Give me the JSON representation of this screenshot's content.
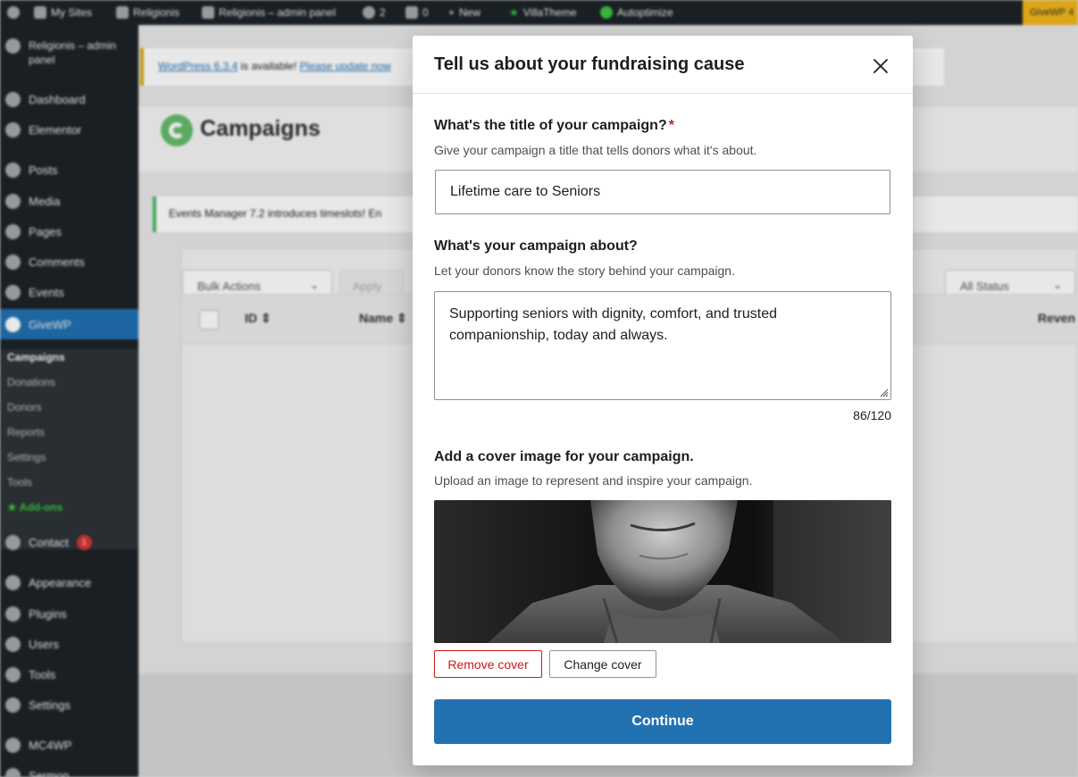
{
  "admin_bar": {
    "my_sites": "My Sites",
    "site_name": "Religionis",
    "admin_panel": "Religionis – admin panel",
    "updates_count": "2",
    "comments_count": "0",
    "new_label": "New",
    "villatheme": "VillaTheme",
    "autoptimize": "Autoptimize",
    "givewp_badge": "GiveWP 4"
  },
  "sidebar": {
    "site_title": "Religionis – admin panel",
    "items": [
      {
        "label": "Dashboard",
        "icon": "dashboard-icon"
      },
      {
        "label": "Elementor",
        "icon": "elementor-icon"
      },
      {
        "label": "Posts",
        "icon": "pin-icon"
      },
      {
        "label": "Media",
        "icon": "media-icon"
      },
      {
        "label": "Pages",
        "icon": "pages-icon"
      },
      {
        "label": "Comments",
        "icon": "comment-icon"
      },
      {
        "label": "Events",
        "icon": "events-icon"
      },
      {
        "label": "GiveWP",
        "icon": "givewp-icon"
      }
    ],
    "sub_items": [
      "Campaigns",
      "Donations",
      "Donors",
      "Reports",
      "Settings",
      "Tools",
      "Add-ons"
    ],
    "items_after": [
      {
        "label": "Contact",
        "icon": "mail-icon",
        "badge": "1"
      },
      {
        "label": "Appearance",
        "icon": "brush-icon"
      },
      {
        "label": "Plugins",
        "icon": "plugin-icon"
      },
      {
        "label": "Users",
        "icon": "users-icon"
      },
      {
        "label": "Tools",
        "icon": "wrench-icon"
      },
      {
        "label": "Settings",
        "icon": "settings-icon"
      },
      {
        "label": "MC4WP",
        "icon": "mc4wp-icon"
      },
      {
        "label": "Sermon",
        "icon": "sermon-icon"
      }
    ]
  },
  "background": {
    "wp_notice": {
      "link1": "WordPress 6.3.4",
      "text": " is available! ",
      "link2": "Please update now"
    },
    "page_title": "Campaigns",
    "events_notice": "Events Manager 7.2 introduces timeslots! En",
    "bulk_actions": "Bulk Actions",
    "apply": "Apply",
    "status_filter": "All Status",
    "columns": {
      "id": "ID",
      "name": "Name",
      "revenue": "Reven"
    }
  },
  "modal": {
    "title": "Tell us about your fundraising cause",
    "close_icon": "close-icon",
    "title_field": {
      "label": "What's the title of your campaign?",
      "required_mark": "*",
      "help": "Give your campaign a title that tells donors what it's about.",
      "value": "Lifetime care to Seniors"
    },
    "description_field": {
      "label": "What's your campaign about?",
      "help": "Let your donors know the story behind your campaign.",
      "value": "Supporting seniors with dignity, comfort, and trusted companionship, today and always.",
      "char_count": "86/120"
    },
    "cover_field": {
      "label": "Add a cover image for your campaign.",
      "help": "Upload an image to represent and inspire your campaign.",
      "remove_label": "Remove cover",
      "change_label": "Change cover"
    },
    "continue_label": "Continue"
  },
  "colors": {
    "primary": "#2271b1",
    "danger": "#cc1818",
    "admin_dark": "#1d2327"
  }
}
